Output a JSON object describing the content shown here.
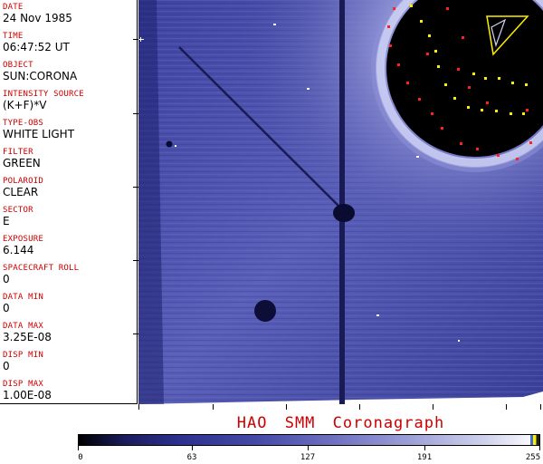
{
  "header_fields": [
    {
      "label": "DATE",
      "value": "24 Nov 1985"
    },
    {
      "label": "TIME",
      "value": "06:47:52 UT"
    },
    {
      "label": "OBJECT",
      "value": "SUN:CORONA"
    },
    {
      "label": "INTENSITY SOURCE",
      "value": "(K+F)*V"
    },
    {
      "label": "TYPE-OBS",
      "value": "WHITE LIGHT"
    },
    {
      "label": "FILTER",
      "value": "GREEN"
    },
    {
      "label": "POLAROID",
      "value": "CLEAR"
    },
    {
      "label": "SECTOR",
      "value": "E"
    },
    {
      "label": "EXPOSURE",
      "value": "6.144"
    },
    {
      "label": "SPACECRAFT ROLL",
      "value": "0"
    },
    {
      "label": "DATA MIN",
      "value": "0"
    },
    {
      "label": "DATA MAX",
      "value": "3.25E-08"
    },
    {
      "label": "DISP MIN",
      "value": "0"
    },
    {
      "label": "DISP MAX",
      "value": "1.00E-08"
    }
  ],
  "caption": "HAO  SMM Coronagraph",
  "colorbar": {
    "tick_labels": [
      "0",
      "63",
      "127",
      "191",
      "255"
    ],
    "tick_values": [
      0,
      63,
      127,
      191,
      255
    ],
    "max_value": 255
  },
  "colors": {
    "label_red": "#cc0000",
    "image_blue": "#4a4fa8",
    "occulter_black": "#000000"
  }
}
